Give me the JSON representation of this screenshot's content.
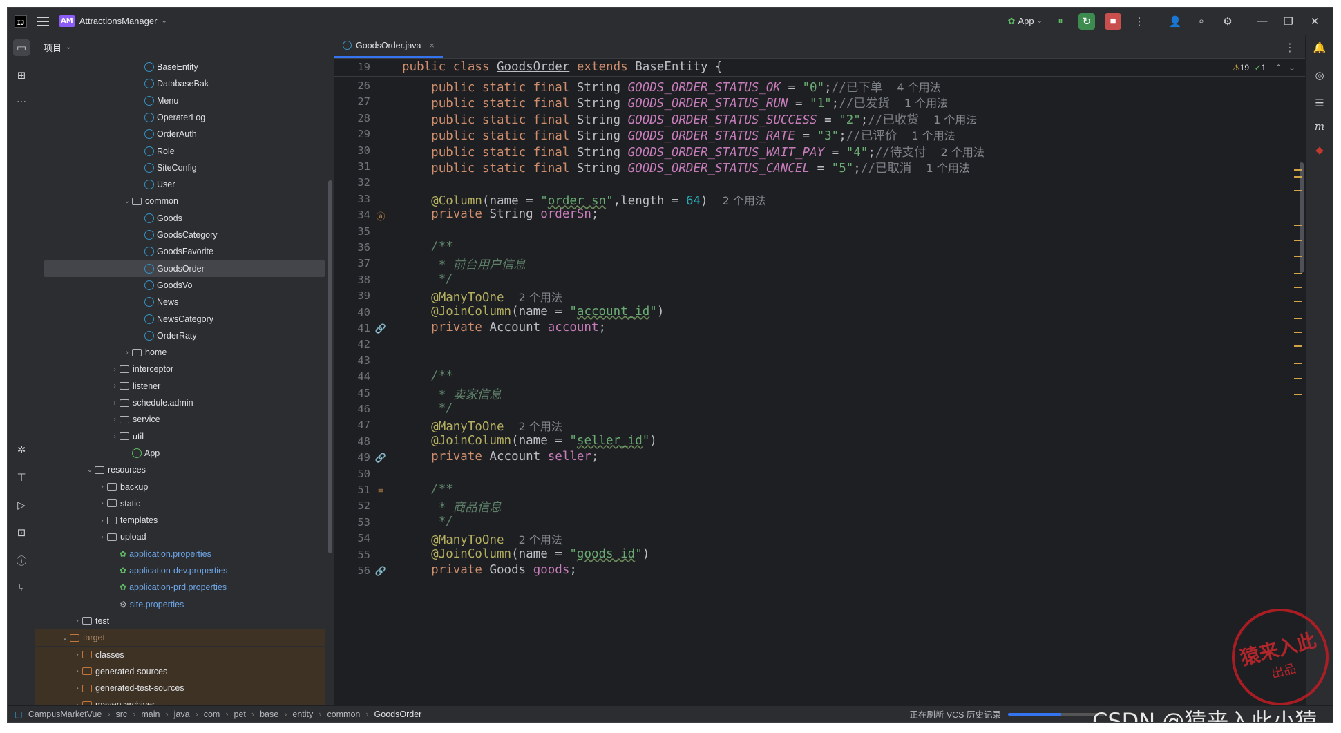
{
  "window": {
    "project_badge": "AM",
    "project_name": "AttractionsManager",
    "run_config": "App",
    "more_icon": "⋮"
  },
  "panel": {
    "title": "项目"
  },
  "tree": [
    {
      "label": "BaseEntity",
      "indent": 8,
      "kind": "class",
      "arrow": ""
    },
    {
      "label": "DatabaseBak",
      "indent": 8,
      "kind": "class",
      "arrow": ""
    },
    {
      "label": "Menu",
      "indent": 8,
      "kind": "class",
      "arrow": ""
    },
    {
      "label": "OperaterLog",
      "indent": 8,
      "kind": "class",
      "arrow": ""
    },
    {
      "label": "OrderAuth",
      "indent": 8,
      "kind": "class",
      "arrow": ""
    },
    {
      "label": "Role",
      "indent": 8,
      "kind": "class",
      "arrow": ""
    },
    {
      "label": "SiteConfig",
      "indent": 8,
      "kind": "class",
      "arrow": ""
    },
    {
      "label": "User",
      "indent": 8,
      "kind": "class",
      "arrow": ""
    },
    {
      "label": "common",
      "indent": 7,
      "kind": "package",
      "arrow": "⌄"
    },
    {
      "label": "Goods",
      "indent": 8,
      "kind": "class",
      "arrow": ""
    },
    {
      "label": "GoodsCategory",
      "indent": 8,
      "kind": "class",
      "arrow": ""
    },
    {
      "label": "GoodsFavorite",
      "indent": 8,
      "kind": "class",
      "arrow": ""
    },
    {
      "label": "GoodsOrder",
      "indent": 8,
      "kind": "class",
      "arrow": "",
      "selected": true
    },
    {
      "label": "GoodsVo",
      "indent": 8,
      "kind": "class",
      "arrow": ""
    },
    {
      "label": "News",
      "indent": 8,
      "kind": "class",
      "arrow": ""
    },
    {
      "label": "NewsCategory",
      "indent": 8,
      "kind": "class",
      "arrow": ""
    },
    {
      "label": "OrderRaty",
      "indent": 8,
      "kind": "class",
      "arrow": ""
    },
    {
      "label": "home",
      "indent": 7,
      "kind": "package",
      "arrow": "›"
    },
    {
      "label": "interceptor",
      "indent": 6,
      "kind": "package",
      "arrow": "›"
    },
    {
      "label": "listener",
      "indent": 6,
      "kind": "package",
      "arrow": "›"
    },
    {
      "label": "schedule.admin",
      "indent": 6,
      "kind": "package",
      "arrow": "›"
    },
    {
      "label": "service",
      "indent": 6,
      "kind": "package",
      "arrow": "›"
    },
    {
      "label": "util",
      "indent": 6,
      "kind": "package",
      "arrow": "›"
    },
    {
      "label": "App",
      "indent": 7,
      "kind": "app",
      "arrow": ""
    },
    {
      "label": "resources",
      "indent": 4,
      "kind": "folder",
      "arrow": "⌄"
    },
    {
      "label": "backup",
      "indent": 5,
      "kind": "folder",
      "arrow": "›"
    },
    {
      "label": "static",
      "indent": 5,
      "kind": "folder",
      "arrow": "›"
    },
    {
      "label": "templates",
      "indent": 5,
      "kind": "folder",
      "arrow": "›"
    },
    {
      "label": "upload",
      "indent": 5,
      "kind": "folder",
      "arrow": "›"
    },
    {
      "label": "application.properties",
      "indent": 6,
      "kind": "props",
      "arrow": ""
    },
    {
      "label": "application-dev.properties",
      "indent": 6,
      "kind": "props",
      "arrow": ""
    },
    {
      "label": "application-prd.properties",
      "indent": 6,
      "kind": "props",
      "arrow": ""
    },
    {
      "label": "site.properties",
      "indent": 6,
      "kind": "gearprops",
      "arrow": ""
    },
    {
      "label": "test",
      "indent": 3,
      "kind": "folder",
      "arrow": "›"
    },
    {
      "label": "target",
      "indent": 2,
      "kind": "excluded",
      "arrow": "⌄"
    },
    {
      "label": "classes",
      "indent": 3,
      "kind": "excludedfolder",
      "arrow": "›"
    },
    {
      "label": "generated-sources",
      "indent": 3,
      "kind": "excludedfolder",
      "arrow": "›"
    },
    {
      "label": "generated-test-sources",
      "indent": 3,
      "kind": "excludedfolder",
      "arrow": "›"
    },
    {
      "label": "maven-archiver",
      "indent": 3,
      "kind": "excludedfolder",
      "arrow": "›"
    }
  ],
  "editor": {
    "tab_label": "GoodsOrder.java",
    "inspections_warn": "19",
    "inspections_ok": "1",
    "sticky": {
      "ln": "19",
      "text": "public class GoodsOrder extends BaseEntity {"
    },
    "lines": [
      {
        "ln": "26",
        "html": "    <span class='kw'>public static final</span> String <span class='cn'>GOODS_ORDER_STATUS_OK</span> = <span class='str'>\"0\"</span>;<span class='cm'>//已下单</span>  <span class='hint'>4 个用法</span>"
      },
      {
        "ln": "27",
        "html": "    <span class='kw'>public static final</span> String <span class='cn'>GOODS_ORDER_STATUS_RUN</span> = <span class='str'>\"1\"</span>;<span class='cm'>//已发货</span>  <span class='hint'>1 个用法</span>"
      },
      {
        "ln": "28",
        "html": "    <span class='kw'>public static final</span> String <span class='cn'>GOODS_ORDER_STATUS_SUCCESS</span> = <span class='str'>\"2\"</span>;<span class='cm'>//已收货</span>  <span class='hint'>1 个用法</span>"
      },
      {
        "ln": "29",
        "html": "    <span class='kw'>public static final</span> String <span class='cn'>GOODS_ORDER_STATUS_RATE</span> = <span class='str'>\"3\"</span>;<span class='cm'>//已评价</span>  <span class='hint'>1 个用法</span>"
      },
      {
        "ln": "30",
        "html": "    <span class='kw'>public static final</span> String <span class='cn'>GOODS_ORDER_STATUS_WAIT_PAY</span> = <span class='str'>\"4\"</span>;<span class='cm'>//待支付</span>  <span class='hint'>2 个用法</span>"
      },
      {
        "ln": "31",
        "html": "    <span class='kw'>public static final</span> String <span class='cn'>GOODS_ORDER_STATUS_CANCEL</span> = <span class='str'>\"5\"</span>;<span class='cm'>//已取消</span>  <span class='hint'>1 个用法</span>"
      },
      {
        "ln": "32",
        "html": ""
      },
      {
        "ln": "33",
        "html": "    <span class='ann'>@Column</span>(name = <span class='str'>\"<span class='und'>order_sn</span>\"</span>,length = <span class='num'>64</span>)  <span class='hint'>2 个用法</span>"
      },
      {
        "ln": "34",
        "html": "    <span class='kw'>private</span> String <span class='fld'>orderSn</span>;",
        "gutter": "ⓐ"
      },
      {
        "ln": "35",
        "html": ""
      },
      {
        "ln": "36",
        "html": "    <span class='doc'>/**</span>"
      },
      {
        "ln": "37",
        "html": "     <span class='doc'>* 前台用户信息</span>"
      },
      {
        "ln": "38",
        "html": "     <span class='doc'>*/</span>"
      },
      {
        "ln": "39",
        "html": "    <span class='ann'>@ManyToOne</span>  <span class='hint'>2 个用法</span>"
      },
      {
        "ln": "40",
        "html": "    <span class='ann'>@JoinColumn</span>(name = <span class='str'>\"<span class='und'>account_id</span>\"</span>)"
      },
      {
        "ln": "41",
        "html": "    <span class='kw'>private</span> Account <span class='fld'>account</span>;",
        "gutter": "🔗"
      },
      {
        "ln": "42",
        "html": ""
      },
      {
        "ln": "43",
        "html": ""
      },
      {
        "ln": "44",
        "html": "    <span class='doc'>/**</span>"
      },
      {
        "ln": "45",
        "html": "     <span class='doc'>* 卖家信息</span>"
      },
      {
        "ln": "46",
        "html": "     <span class='doc'>*/</span>"
      },
      {
        "ln": "47",
        "html": "    <span class='ann'>@ManyToOne</span>  <span class='hint'>2 个用法</span>"
      },
      {
        "ln": "48",
        "html": "    <span class='ann'>@JoinColumn</span>(name = <span class='str'>\"<span class='und'>seller_id</span>\"</span>)"
      },
      {
        "ln": "49",
        "html": "    <span class='kw'>private</span> Account <span class='fld'>seller</span>;",
        "gutter": "🔗"
      },
      {
        "ln": "50",
        "html": ""
      },
      {
        "ln": "51",
        "html": "    <span class='doc'>/**</span>",
        "gutter": "≣"
      },
      {
        "ln": "52",
        "html": "     <span class='doc'>* 商品信息</span>"
      },
      {
        "ln": "53",
        "html": "     <span class='doc'>*/</span>"
      },
      {
        "ln": "54",
        "html": "    <span class='ann'>@ManyToOne</span>  <span class='hint'>2 个用法</span>"
      },
      {
        "ln": "55",
        "html": "    <span class='ann'>@JoinColumn</span>(name = <span class='str'>\"<span class='und'>goods_id</span>\"</span>)"
      },
      {
        "ln": "56",
        "html": "    <span class='kw'>private</span> Goods <span class='fld'>goods</span>;",
        "gutter": "🔗"
      }
    ]
  },
  "status": {
    "breadcrumbs": [
      "CampusMarketVue",
      "src",
      "main",
      "java",
      "com",
      "pet",
      "base",
      "entity",
      "common",
      "GoodsOrder"
    ],
    "task": "正在刷新 VCS 历史记录",
    "progress": 0.55
  },
  "watermark": {
    "stamp_top": "猿来入此",
    "stamp_bottom": "出品",
    "text": "CSDN @猿来入此小猿"
  }
}
